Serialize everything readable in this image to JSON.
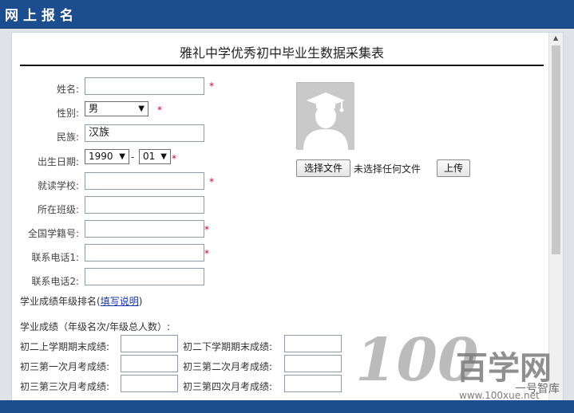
{
  "header": {
    "title": "网上报名"
  },
  "form": {
    "title": "雅礼中学优秀初中毕业生数据采集表",
    "fields": {
      "name": {
        "label": "姓名:",
        "value": ""
      },
      "gender": {
        "label": "性别:",
        "value": "男"
      },
      "ethnicity": {
        "label": "民族:",
        "value": "汉族"
      },
      "birthdate": {
        "label": "出生日期:",
        "year": "1990",
        "month": "01",
        "separator": "-"
      },
      "school": {
        "label": "就读学校:",
        "value": ""
      },
      "class": {
        "label": "所在班级:",
        "value": ""
      },
      "student_id": {
        "label": "全国学籍号:",
        "value": ""
      },
      "phone1": {
        "label": "联系电话1:",
        "value": ""
      },
      "phone2": {
        "label": "联系电话2:",
        "value": ""
      }
    },
    "required_mark": "*"
  },
  "photo_upload": {
    "choose_file_label": "选择文件",
    "file_status": "未选择任何文件",
    "upload_label": "上传"
  },
  "ranking": {
    "label": "学业成绩年级排名",
    "paren_open": "(",
    "link": "填写说明",
    "paren_close": ")"
  },
  "scores": {
    "heading": "学业成绩（年级名次/年级总人数）:",
    "rows": [
      {
        "left_label": "初二上学期期末成绩:",
        "right_label": "初二下学期期末成绩:"
      },
      {
        "left_label": "初三第一次月考成绩:",
        "right_label": "初三第二次月考成绩:"
      },
      {
        "left_label": "初三第三次月考成绩:",
        "right_label": "初三第四次月考成绩:"
      }
    ]
  },
  "watermark": {
    "big_number": "100",
    "brand": "百学网",
    "handle": "一号智库",
    "url": "www.100xue.net"
  },
  "colors": {
    "header_bg": "#1c4d8f",
    "required": "#cc0033",
    "link": "#1a33a8"
  },
  "icons": {
    "photo_placeholder": "graduate-avatar-icon",
    "dropdown": "chevron-down-icon",
    "scroll_up": "scroll-up-arrow-icon"
  }
}
